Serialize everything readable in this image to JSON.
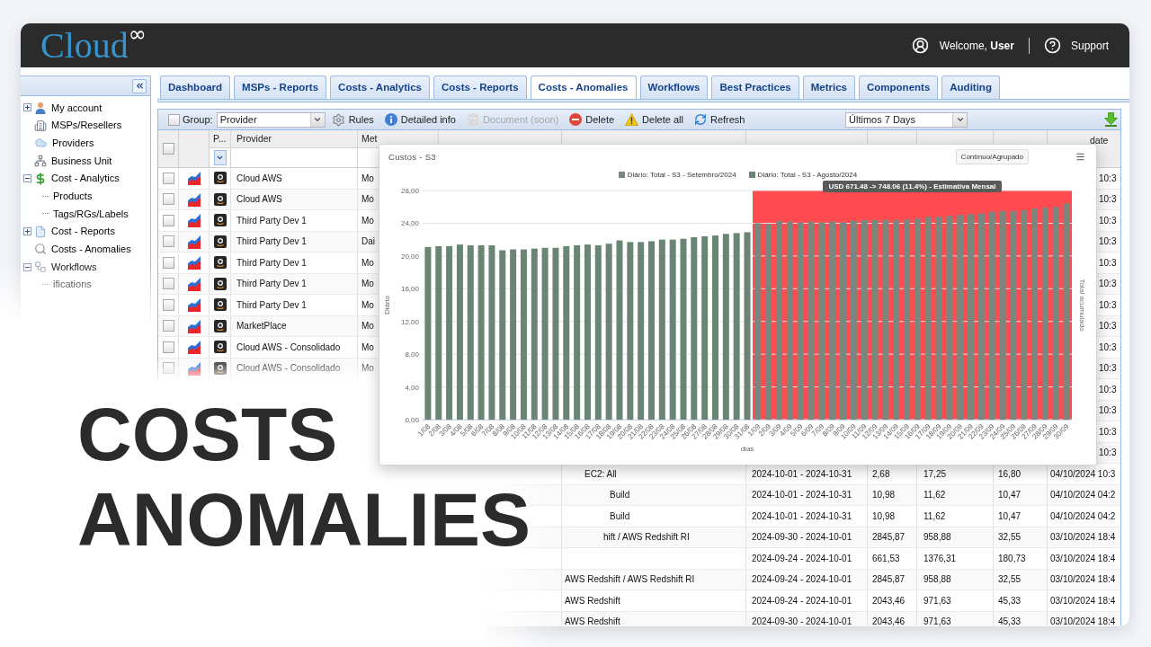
{
  "header": {
    "logo": {
      "text": "Cloud",
      "mark": "∞"
    },
    "welcome": "Welcome, **User**",
    "support": "Support"
  },
  "sidebar": {
    "items": [
      {
        "label": "My account",
        "has_children": true,
        "expanded": false
      },
      {
        "label": "MSPs/Resellers",
        "has_children": false,
        "expanded": false
      },
      {
        "label": "Providers",
        "has_children": false,
        "expanded": false
      },
      {
        "label": "Business Unit",
        "has_children": false,
        "expanded": false
      },
      {
        "label": "Cost - Analytics",
        "has_children": true,
        "expanded": true,
        "children": [
          {
            "label": "Products"
          },
          {
            "label": "Tags/RGs/Labels"
          }
        ]
      },
      {
        "label": "Cost - Reports",
        "has_children": true,
        "expanded": false
      },
      {
        "label": "Costs - Anomalies",
        "has_children": false,
        "expanded": false
      },
      {
        "label": "Workflows",
        "has_children": true,
        "expanded": true,
        "children": [
          {
            "label": "ifications"
          }
        ]
      }
    ]
  },
  "tabs": [
    {
      "label": "Dashboard",
      "selected": false
    },
    {
      "label": "MSPs - Reports",
      "selected": false
    },
    {
      "label": "Costs - Analytics",
      "selected": false
    },
    {
      "label": "Costs - Reports",
      "selected": false
    },
    {
      "label": "Costs - Anomalies",
      "selected": true
    },
    {
      "label": "Workflows",
      "selected": false
    },
    {
      "label": "Best Practices",
      "selected": false
    },
    {
      "label": "Metrics",
      "selected": false
    },
    {
      "label": "Components",
      "selected": false
    },
    {
      "label": "Auditing",
      "selected": false
    }
  ],
  "toolbar": {
    "group": {
      "label": "Group:",
      "checked": false,
      "value": "Provider"
    },
    "actions": [
      {
        "label": "Rules",
        "disabled": false
      },
      {
        "label": "Detailed info",
        "disabled": false
      },
      {
        "label": "Document (soon)",
        "disabled": true
      },
      {
        "label": "Delete",
        "disabled": false
      },
      {
        "label": "Delete all",
        "disabled": false
      },
      {
        "label": "Refresh",
        "disabled": false
      }
    ],
    "period": "Últimos 7 Days"
  },
  "table": {
    "select_all_checked": false,
    "header": {
      "provider_type": "P...",
      "provider": "Provider",
      "method": "Met",
      "updated": "date"
    },
    "rows": [
      {
        "kind": "provider",
        "checked": false,
        "provider": "Cloud AWS",
        "method": "Mo",
        "updated": "10:3"
      },
      {
        "kind": "provider",
        "checked": false,
        "provider": "Cloud AWS",
        "method": "Mo",
        "updated": "10:3"
      },
      {
        "kind": "provider",
        "checked": false,
        "provider": "Third Party Dev 1",
        "method": "Mo",
        "updated": "10:3"
      },
      {
        "kind": "provider",
        "checked": false,
        "provider": "Third Party Dev 1",
        "method": "Dai",
        "updated": "10:3"
      },
      {
        "kind": "provider",
        "checked": false,
        "provider": "Third Party Dev 1",
        "method": "Mo",
        "updated": "10:3"
      },
      {
        "kind": "provider",
        "checked": false,
        "provider": "Third Party Dev 1",
        "method": "Mo",
        "updated": "10:3"
      },
      {
        "kind": "provider",
        "checked": false,
        "provider": "Third Party Dev 1",
        "method": "Mo",
        "updated": "10:3"
      },
      {
        "kind": "provider",
        "checked": false,
        "provider": "MarketPlace",
        "method": "Mo",
        "updated": "10:3"
      },
      {
        "kind": "provider",
        "checked": false,
        "provider": "Cloud AWS - Consolidado",
        "method": "Mo",
        "updated": "10:3"
      },
      {
        "kind": "provider",
        "checked": false,
        "provider": "Cloud AWS - Consolidado",
        "method": "Mo",
        "updated": "10:3"
      },
      {
        "kind": "covered",
        "updated": "10:3"
      },
      {
        "kind": "covered",
        "updated": "10:3"
      },
      {
        "kind": "covered",
        "updated": "10:3"
      },
      {
        "kind": "covered",
        "updated": "10:3"
      },
      {
        "kind": "detail",
        "service": "EC2: All",
        "period": "2024-10-01 - 2024-10-31",
        "value_1": "2,68",
        "value_2": "17,25",
        "value_3": "16,80",
        "updated": "04/10/2024 10:3"
      },
      {
        "kind": "detail",
        "service": "Build",
        "period": "2024-10-01 - 2024-10-31",
        "value_1": "10,98",
        "value_2": "11,62",
        "value_3": "10,47",
        "updated": "04/10/2024 04:2"
      },
      {
        "kind": "detail",
        "service": "Build",
        "period": "2024-10-01 - 2024-10-31",
        "value_1": "10,98",
        "value_2": "11,62",
        "value_3": "10,47",
        "updated": "04/10/2024 04:2"
      },
      {
        "kind": "detail",
        "service": "hift / AWS Redshift RI",
        "period": "2024-09-30 - 2024-10-01",
        "value_1": "2845,87",
        "value_2": "958,88",
        "value_3": "32,55",
        "updated": "03/10/2024 18:4"
      },
      {
        "kind": "detail",
        "period": "2024-09-24 - 2024-10-01",
        "value_1": "661,53",
        "value_2": "1376,31",
        "value_3": "180,73",
        "updated": "03/10/2024 18:4"
      },
      {
        "kind": "detail",
        "service": "AWS Redshift / AWS Redshift RI",
        "period": "2024-09-24 - 2024-10-01",
        "value_1": "2845,87",
        "value_2": "958,88",
        "value_3": "32,55",
        "updated": "03/10/2024 18:4"
      },
      {
        "kind": "detail",
        "service": "AWS Redshift",
        "period": "2024-09-24 - 2024-10-01",
        "value_1": "2043,46",
        "value_2": "971,63",
        "value_3": "45,33",
        "updated": "03/10/2024 18:4"
      },
      {
        "kind": "detail",
        "service": "AWS Redshift",
        "period": "2024-09-30 - 2024-10-01",
        "value_1": "2043,46",
        "value_2": "971,63",
        "value_3": "45,33",
        "updated": "03/10/2024 18:4"
      }
    ]
  },
  "chart": {
    "title": "Custos - S3",
    "mode_button": "Contínuo/Agrupado",
    "right_axis_title": "Total acumulado",
    "estimate_label": "USD 671.48 -> 748.06 (11.4%) - Estimativa Mensal",
    "chart_data": {
      "type": "bar",
      "xlabel": "dias",
      "ylabel": "Diário",
      "categories": [
        "1/08",
        "2/08",
        "3/08",
        "4/08",
        "5/08",
        "6/08",
        "7/08",
        "8/08",
        "9/08",
        "10/08",
        "11/08",
        "12/08",
        "13/08",
        "14/08",
        "15/08",
        "16/08",
        "17/08",
        "18/08",
        "19/08",
        "20/08",
        "21/08",
        "22/08",
        "23/08",
        "24/08",
        "25/08",
        "26/08",
        "27/08",
        "28/08",
        "29/08",
        "30/08",
        "31/08",
        "1/09",
        "2/09",
        "3/09",
        "4/09",
        "5/09",
        "6/09",
        "7/09",
        "8/09",
        "9/09",
        "10/09",
        "11/09",
        "12/09",
        "13/09",
        "14/09",
        "15/09",
        "16/09",
        "17/09",
        "18/09",
        "19/09",
        "20/09",
        "21/09",
        "22/09",
        "23/09",
        "24/09",
        "25/09",
        "26/09",
        "27/09",
        "28/09",
        "29/09",
        "30/09"
      ],
      "series": [
        {
          "name": "Diário: Total - S3 - Setembro/2024",
          "color": "#7a877e",
          "values": [
            null,
            null,
            null,
            null,
            null,
            null,
            null,
            null,
            null,
            null,
            null,
            null,
            null,
            null,
            null,
            null,
            null,
            null,
            null,
            null,
            null,
            null,
            null,
            null,
            null,
            null,
            null,
            null,
            null,
            null,
            null,
            24.0,
            23.9,
            24.3,
            24.2,
            24.1,
            24.2,
            24.1,
            24.2,
            24.1,
            24.3,
            24.4,
            24.4,
            24.4,
            24.4,
            24.5,
            24.6,
            24.8,
            24.8,
            24.9,
            25.0,
            25.1,
            25.2,
            25.4,
            25.5,
            25.5,
            25.6,
            25.8,
            25.9,
            26.0,
            26.4
          ]
        },
        {
          "name": "Diário: Total - S3 - Agosto/2024",
          "color": "#6b8574",
          "values": [
            21.1,
            21.2,
            21.2,
            21.4,
            21.3,
            21.3,
            21.3,
            20.7,
            20.8,
            20.8,
            20.9,
            21.0,
            21.0,
            21.2,
            21.3,
            21.4,
            21.3,
            21.5,
            21.9,
            21.7,
            21.7,
            21.8,
            22.0,
            22.0,
            22.1,
            22.3,
            22.4,
            22.5,
            22.7,
            22.8,
            22.9,
            null,
            null,
            null,
            null,
            null,
            null,
            null,
            null,
            null,
            null,
            null,
            null,
            null,
            null,
            null,
            null,
            null,
            null,
            null,
            null,
            null,
            null,
            null,
            null,
            null,
            null,
            null,
            null,
            null,
            null
          ]
        }
      ],
      "ylim": [
        0,
        28
      ],
      "yticks": [
        {
          "value": 0,
          "label": "0,00"
        },
        {
          "value": 4,
          "label": "4,00"
        },
        {
          "value": 8,
          "label": "8,00"
        },
        {
          "value": 12,
          "label": "12,00"
        },
        {
          "value": 16,
          "label": "16,00"
        },
        {
          "value": 20,
          "label": "20,00"
        },
        {
          "value": 24,
          "label": "24,00"
        },
        {
          "value": 28,
          "label": "28,00"
        }
      ],
      "grid": true,
      "legend": "top"
    }
  },
  "overlay_title": {
    "lines": [
      "COSTS",
      "ANOMALIES"
    ]
  }
}
